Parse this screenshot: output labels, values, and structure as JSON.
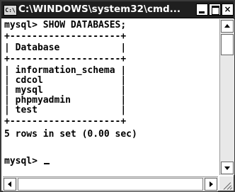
{
  "window": {
    "title": "C:\\WINDOWS\\system32\\cmd...",
    "icon_label": "C:\\",
    "minimize_icon": "minimize-icon",
    "maximize_icon": "maximize-icon",
    "close_label": "×"
  },
  "console": {
    "lines": [
      "mysql> SHOW DATABASES;",
      "+--------------------+",
      "| Database           |",
      "+--------------------+",
      "| information_schema |",
      "| cdcol              |",
      "| mysql              |",
      "| phpmyadmin         |",
      "| test               |",
      "+--------------------+",
      "5 rows in set (0.00 sec)",
      "",
      "mysql> "
    ]
  },
  "scrollbars": {
    "vertical": {
      "up_icon": "arrow-up-icon",
      "down_icon": "arrow-down-icon"
    },
    "horizontal": {
      "left_icon": "arrow-left-icon",
      "right_icon": "arrow-right-icon"
    }
  }
}
